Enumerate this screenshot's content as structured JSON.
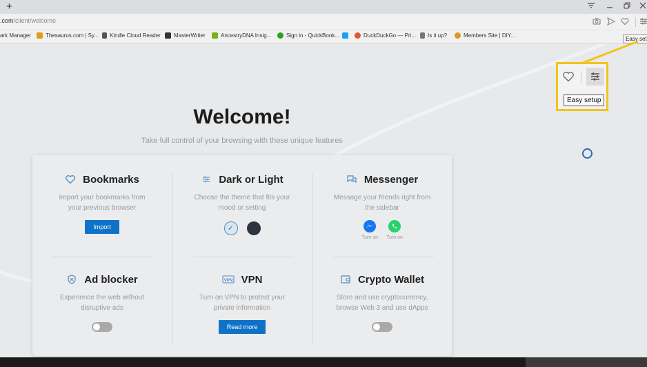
{
  "browser": {
    "new_tab": "+",
    "controls": [
      "minimize",
      "maximize",
      "close"
    ],
    "url_host": ".com",
    "url_path": "/client/welcome",
    "address_icons": [
      "camera-icon",
      "send-icon",
      "heart-icon",
      "sliders-icon"
    ],
    "toolbar_tooltip": "Easy setup"
  },
  "bookmarks": [
    {
      "label": "ark Manager",
      "color": "#8e8e8e"
    },
    {
      "label": "Thesaurus.com | Sy...",
      "color": "#e39b1b"
    },
    {
      "label": "Kindle Cloud Reader",
      "color": "#555555"
    },
    {
      "label": "MasterWriter",
      "color": "#333333"
    },
    {
      "label": "AncestryDNA Insig...",
      "color": "#7ab317"
    },
    {
      "label": "Sign in - QuickBook...",
      "color": "#2ca01c"
    },
    {
      "label": "",
      "color": "#1da1f2"
    },
    {
      "label": "DuckDuckGo — Pri...",
      "color": "#de5833"
    },
    {
      "label": "Is it up?",
      "color": "#777777"
    },
    {
      "label": "Members Site | DIY...",
      "color": "#d99a1e"
    }
  ],
  "welcome": {
    "title": "Welcome!",
    "subtitle": "Take full control of your browsing with these unique features"
  },
  "features": {
    "bookmarks": {
      "title": "Bookmarks",
      "desc1": "Import your bookmarks from",
      "desc2": "your previous browser",
      "button": "Import"
    },
    "theme": {
      "title": "Dark or Light",
      "desc1": "Choose the theme that fits your",
      "desc2": "mood or setting",
      "selected": "light"
    },
    "messenger": {
      "title": "Messenger",
      "desc1": "Message your friends right from",
      "desc2": "the sidebar",
      "apps": [
        {
          "name": "messenger-icon",
          "label": "Turn on",
          "color": "#1877f2"
        },
        {
          "name": "whatsapp-icon",
          "label": "Turn on",
          "color": "#25d366"
        }
      ]
    },
    "adblocker": {
      "title": "Ad blocker",
      "desc1": "Experience the web without",
      "desc2": "disruptive ads",
      "enabled": false
    },
    "vpn": {
      "title": "VPN",
      "desc1": "Turn on VPN to protect your",
      "desc2": "private information",
      "button": "Read more"
    },
    "wallet": {
      "title": "Crypto Wallet",
      "desc1": "Store and use cryptocurrency,",
      "desc2": "browse Web 3 and use dApps",
      "enabled": false
    }
  },
  "callout": {
    "tooltip": "Easy setup",
    "highlight_color": "#f2c31b"
  },
  "accent": "#0e73c8"
}
